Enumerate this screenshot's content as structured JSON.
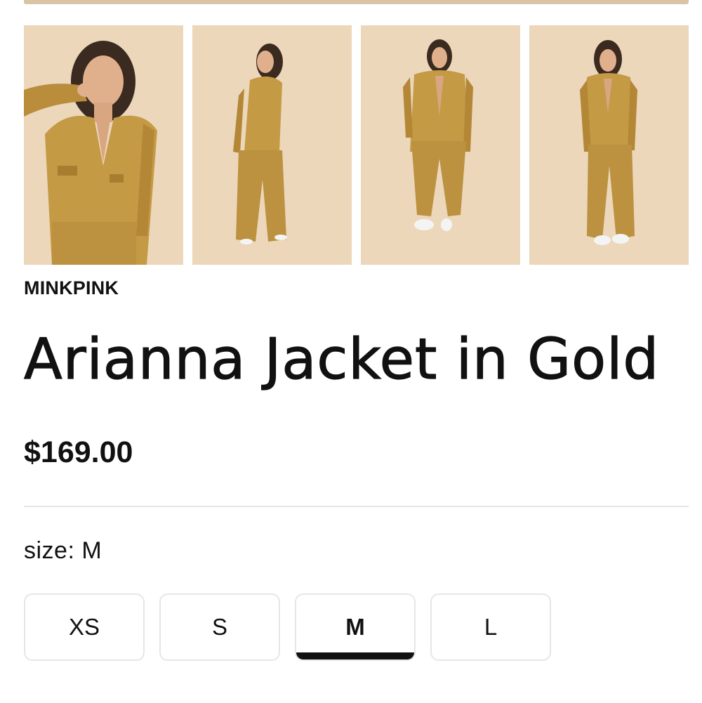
{
  "product": {
    "brand": "MINKPINK",
    "title": "Arianna Jacket in Gold",
    "price": "$169.00"
  },
  "gallery": {
    "images": [
      {
        "name": "Model in gold jacket, close-up pose"
      },
      {
        "name": "Model in gold suit, side view"
      },
      {
        "name": "Model in gold suit, front view"
      },
      {
        "name": "Model in gold suit, three-quarter view"
      }
    ]
  },
  "size": {
    "label": "size: M",
    "selected": "M",
    "options": [
      "XS",
      "S",
      "M",
      "L"
    ]
  },
  "colors": {
    "accent": "#111111",
    "photo_background": "#ecd7bb",
    "garment": "#c49a45",
    "divider": "#e5e5e5"
  }
}
